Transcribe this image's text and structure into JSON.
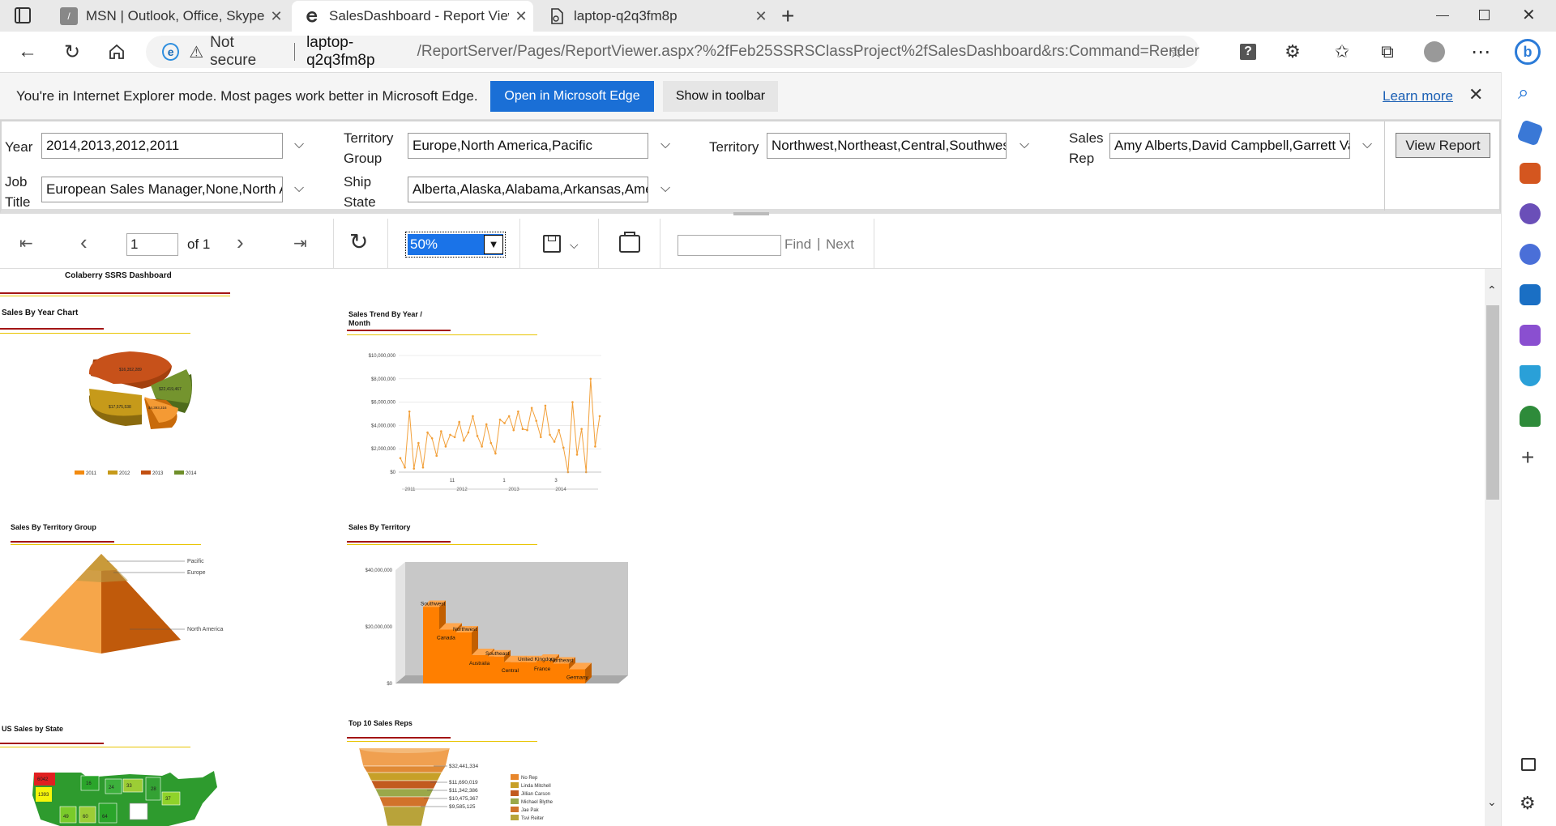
{
  "tabs": [
    {
      "title": "MSN | Outlook, Office, Skype, Bing",
      "icon": "msn-icon"
    },
    {
      "title": "SalesDashboard - Report Viewer",
      "icon": "ie-icon"
    },
    {
      "title": "laptop-q2q3fm8p",
      "icon": "page-icon"
    }
  ],
  "address": {
    "security": "Not secure",
    "host": "laptop-q2q3fm8p",
    "path": "/ReportServer/Pages/ReportViewer.aspx?%2fFeb25SSRSClassProject%2fSalesDashboard&rs:Command=Render"
  },
  "iebar": {
    "message": "You're in Internet Explorer mode. Most pages work better in Microsoft Edge.",
    "open_label": "Open in Microsoft Edge",
    "toolbar_label": "Show in toolbar",
    "learn_more": "Learn more"
  },
  "params": {
    "year_label": "Year",
    "year_value": "2014,2013,2012,2011",
    "tgroup_label": [
      "Territory",
      "Group"
    ],
    "tgroup_value": "Europe,North America,Pacific",
    "territory_label": "Territory",
    "territory_value": "Northwest,Northeast,Central,Southwest,",
    "salesrep_label": [
      "Sales",
      "Rep"
    ],
    "salesrep_value": "Amy Alberts,David Campbell,Garrett Vargas",
    "jobtitle_label": [
      "Job",
      "Title"
    ],
    "jobtitle_value": "European Sales Manager,None,North American",
    "shipstate_label": [
      "Ship",
      "State"
    ],
    "shipstate_value": "Alberta,Alaska,Alabama,Arkansas,American",
    "view_report": "View Report"
  },
  "toolbar": {
    "page": "1",
    "of": "of 1",
    "zoom": "50%",
    "find": "Find",
    "next": "Next",
    "separator": "|"
  },
  "report": {
    "title": "Colaberry SSRS Dashboard",
    "sales_by_year": {
      "title": "Sales By Year Chart",
      "labels": [
        "$16,352,289",
        "$22,419,467",
        "$17,575,538",
        "$4,393,316"
      ]
    },
    "trend": {
      "title": [
        "Sales Trend By Year /",
        "Month"
      ]
    },
    "territory_group": {
      "title": "Sales By Territory Group"
    },
    "territory": {
      "title": "Sales By Territory"
    },
    "us_state": {
      "title": "US Sales by State",
      "map_labels": [
        "6042",
        "1393",
        "16",
        "24",
        "60",
        "64",
        "49",
        "33",
        "28",
        "37"
      ]
    },
    "top10": {
      "title": "Top 10 Sales Reps"
    }
  },
  "chart_data": [
    {
      "type": "pie",
      "title": "Sales By Year Chart",
      "categories": [
        "2011",
        "2012",
        "2013",
        "2014"
      ],
      "values": [
        4393316,
        17575538,
        16352289,
        22419467
      ],
      "colors": [
        "#f28a0f",
        "#c69a1a",
        "#c24f12",
        "#6f8f2a"
      ]
    },
    {
      "type": "line",
      "title": "Sales Trend By Year / Month",
      "y": [
        1200000,
        400000,
        5200000,
        300000,
        2500000,
        400000,
        3400000,
        2900000,
        1400000,
        3500000,
        2200000,
        3200000,
        3000000,
        4300000,
        2700000,
        3400000,
        4800000,
        3100000,
        2200000,
        4100000,
        2500000,
        1600000,
        4500000,
        4200000,
        4800000,
        3600000,
        5200000,
        3700000,
        3600000,
        5500000,
        4400000,
        3000000,
        5700000,
        3200000,
        2600000,
        3600000,
        2100000,
        0,
        6000000,
        1500000,
        3700000,
        0,
        8000000,
        2200000,
        4800000
      ],
      "ylim": [
        0,
        10000000
      ],
      "y_ticks": [
        "$0",
        "$2,000,000",
        "$4,000,000",
        "$6,000,000",
        "$8,000,000",
        "$10,000,000"
      ],
      "x_ticks": [
        "11",
        "1",
        "3"
      ],
      "x_groups": [
        "2011",
        "2012",
        "2013",
        "2014"
      ],
      "color": "#f2a03a"
    },
    {
      "type": "pyramid",
      "title": "Sales By Territory Group",
      "categories": [
        "Pacific",
        "Europe",
        "North America"
      ],
      "shares": [
        0.07,
        0.14,
        0.79
      ]
    },
    {
      "type": "bar",
      "title": "Sales By Territory",
      "categories": [
        "Southwest",
        "Canada",
        "Northwest",
        "Australia",
        "Southeast",
        "Central",
        "United Kingdom",
        "France",
        "Northeast",
        "Germany"
      ],
      "values": [
        27000000,
        19000000,
        18000000,
        10000000,
        9500000,
        7500000,
        7500000,
        8000000,
        7000000,
        5000000
      ],
      "ylim": [
        0,
        40000000
      ],
      "y_ticks": [
        "$0",
        "$20,000,000",
        "$40,000,000"
      ],
      "color": "#ff7f00"
    },
    {
      "type": "funnel",
      "title": "Top 10 Sales Reps",
      "categories": [
        "No Rep",
        "Linda Mitchell",
        "Jillian Carson",
        "Michael Blythe",
        "Jae Pak",
        "Tsvi Reiter"
      ],
      "value_labels": [
        "$32,441,334",
        "$11,690,019",
        "$11,342,386",
        "$10,475,367",
        "$9,585,125"
      ],
      "colors": [
        "#e8862b",
        "#c7a028",
        "#c25a1e",
        "#9aa84a",
        "#d1722b",
        "#b8a33a"
      ]
    }
  ]
}
